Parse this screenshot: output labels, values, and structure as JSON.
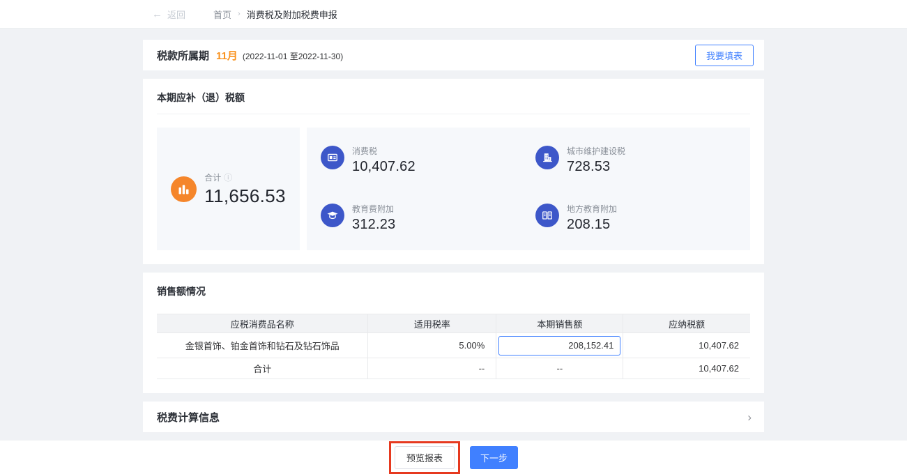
{
  "breadcrumb": {
    "back_arrow": "←",
    "back_label": "返回",
    "home": "首页",
    "separator": "›",
    "current": "消费税及附加税费申报"
  },
  "period": {
    "label": "税款所属期",
    "month": "11月",
    "range": "(2022-11-01 至2022-11-30)",
    "fill_button": "我要填表"
  },
  "summary": {
    "title": "本期应补（退）税额",
    "total": {
      "label": "合计",
      "info_icon": "ⓘ",
      "value": "11,656.53"
    },
    "items": [
      {
        "label": "消费税",
        "value": "10,407.62",
        "icon": "tax-document-icon"
      },
      {
        "label": "城市维护建设税",
        "value": "728.53",
        "icon": "building-icon"
      },
      {
        "label": "教育费附加",
        "value": "312.23",
        "icon": "graduation-cap-icon"
      },
      {
        "label": "地方教育附加",
        "value": "208.15",
        "icon": "ledger-book-icon"
      }
    ]
  },
  "sales": {
    "title": "销售额情况",
    "columns": [
      "应税消费品名称",
      "适用税率",
      "本期销售额",
      "应纳税额"
    ],
    "rows": [
      {
        "name": "金银首饰、铂金首饰和钻石及钻石饰品",
        "rate": "5.00%",
        "sales_input": "208,152.41",
        "tax": "10,407.62"
      },
      {
        "name": "合计",
        "rate": "--",
        "sales": "--",
        "tax": "10,407.62"
      }
    ]
  },
  "tax_calc": {
    "title": "税费计算信息",
    "chevron": "›"
  },
  "footer": {
    "preview_button": "预览报表",
    "next_button": "下一步"
  },
  "colors": {
    "accent_blue": "#4080ff",
    "icon_blue": "#3d57c9",
    "total_orange": "#f5862b",
    "month_orange": "#f9921e",
    "highlight_red": "#e6391f",
    "card_bg": "#f6f8fb"
  }
}
